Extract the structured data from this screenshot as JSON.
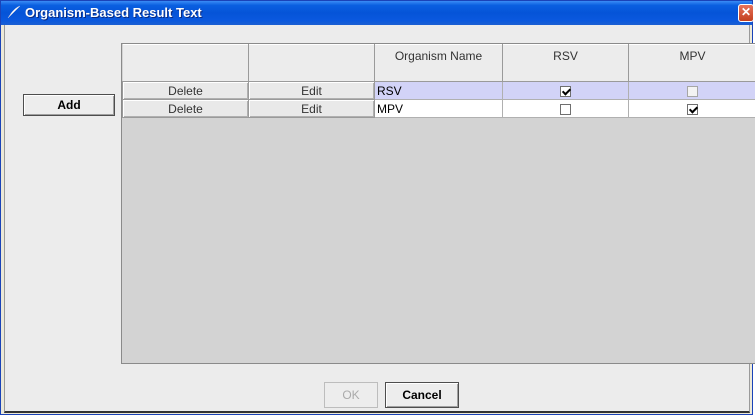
{
  "window": {
    "title": "Organism-Based Result Text",
    "close_glyph": "✕",
    "icon": "quill-icon"
  },
  "buttons": {
    "add": "Add",
    "ok": "OK",
    "cancel": "Cancel"
  },
  "table": {
    "columns": [
      "",
      "",
      "Organism Name",
      "RSV",
      "MPV"
    ],
    "rows": [
      {
        "delete": "Delete",
        "edit": "Edit",
        "name": "RSV",
        "rsv": true,
        "mpv": false,
        "mpv_disabled": true,
        "selected": true
      },
      {
        "delete": "Delete",
        "edit": "Edit",
        "name": "MPV",
        "rsv": false,
        "mpv": true,
        "mpv_disabled": false,
        "selected": false
      }
    ]
  },
  "colors": {
    "title_bar": "#0554d8",
    "selected_row": "#d2d3f7",
    "table_background": "#d3d3d3"
  }
}
